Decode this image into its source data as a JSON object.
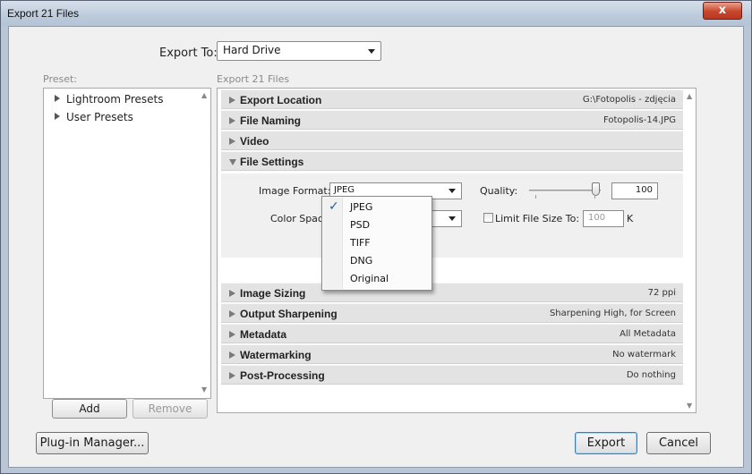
{
  "window": {
    "title": "Export 21 Files",
    "close_label": "x"
  },
  "export_to": {
    "label": "Export To:",
    "value": "Hard Drive",
    "subtitle": "Export 21 Files"
  },
  "preset": {
    "label": "Preset:",
    "items": [
      "Lightroom Presets",
      "User Presets"
    ],
    "add_label": "Add",
    "remove_label": "Remove"
  },
  "sections": [
    {
      "title": "Export Location",
      "summary": "G:\\Fotopolis - zdjęcia",
      "expanded": false
    },
    {
      "title": "File Naming",
      "summary": "Fotopolis-14.JPG",
      "expanded": false
    },
    {
      "title": "Video",
      "summary": "",
      "expanded": false
    },
    {
      "title": "File Settings",
      "summary": "",
      "expanded": true
    },
    {
      "title": "Image Sizing",
      "summary": "72 ppi",
      "expanded": false
    },
    {
      "title": "Output Sharpening",
      "summary": "Sharpening High, for Screen",
      "expanded": false
    },
    {
      "title": "Metadata",
      "summary": "All Metadata",
      "expanded": false
    },
    {
      "title": "Watermarking",
      "summary": "No watermark",
      "expanded": false
    },
    {
      "title": "Post-Processing",
      "summary": "Do nothing",
      "expanded": false
    }
  ],
  "file_settings": {
    "image_format_label": "Image Format:",
    "image_format_value": "JPEG",
    "color_space_label": "Color Space:",
    "quality_label": "Quality:",
    "quality_value": "100",
    "limit_size_label": "Limit File Size To:",
    "limit_size_value": "100",
    "limit_size_unit": "K",
    "limit_size_checked": false
  },
  "format_menu": {
    "options": [
      "JPEG",
      "PSD",
      "TIFF",
      "DNG",
      "Original"
    ],
    "selected": "JPEG",
    "check_glyph": "✓"
  },
  "footer": {
    "plugin_manager_label": "Plug-in Manager...",
    "export_label": "Export",
    "cancel_label": "Cancel"
  },
  "colors": {
    "accent": "#3c7fb1",
    "section_bg": "#e3e3e3",
    "close_button": "#c8452c"
  },
  "icons": {
    "collapsed": "triangle-right-icon",
    "expanded": "triangle-down-icon",
    "dropdown": "chevron-down-icon",
    "check": "check-icon"
  }
}
